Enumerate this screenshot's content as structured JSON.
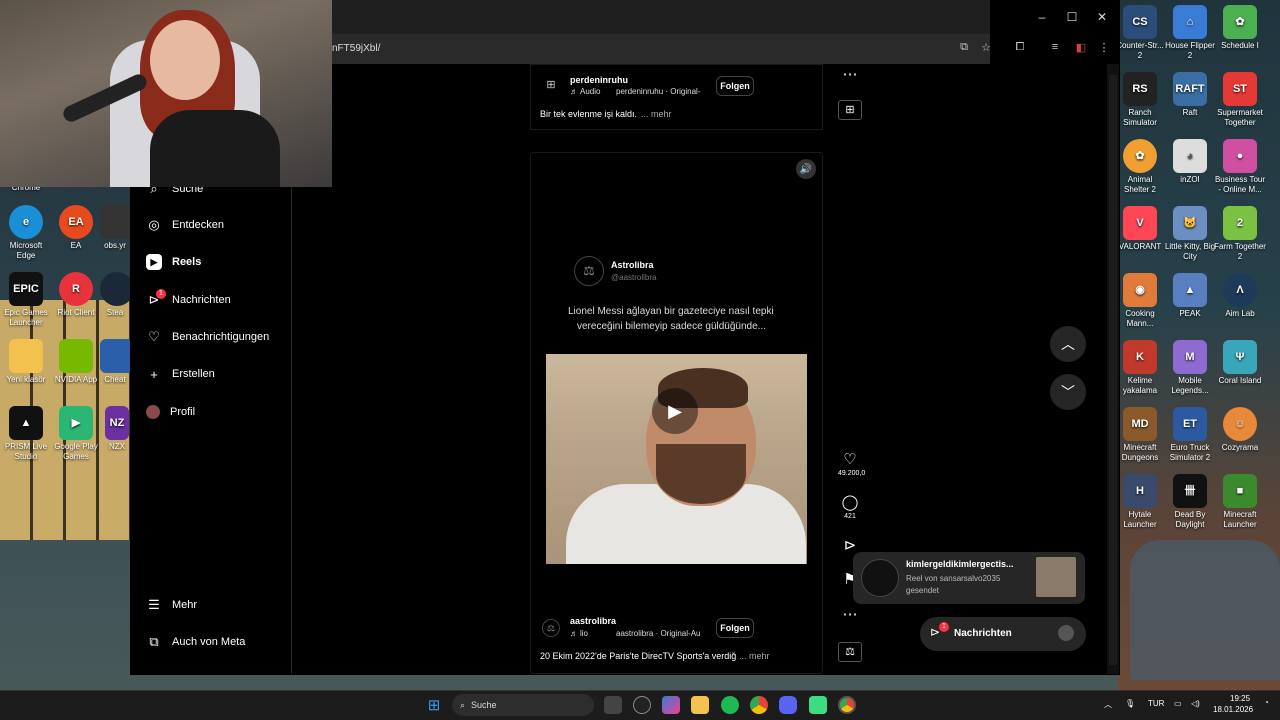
{
  "browser": {
    "url": "nFT59jXbl/",
    "window_controls": {
      "minimize": "–",
      "maximize": "☐",
      "close": "✕"
    }
  },
  "instagram": {
    "nav": [
      {
        "label": "Suche",
        "icon": "search-icon"
      },
      {
        "label": "Entdecken",
        "icon": "compass-icon"
      },
      {
        "label": "Reels",
        "icon": "reels-icon"
      },
      {
        "label": "Nachrichten",
        "icon": "messages-icon",
        "badge": "1"
      },
      {
        "label": "Benachrichtigungen",
        "icon": "heart-icon"
      },
      {
        "label": "Erstellen",
        "icon": "plus-icon"
      },
      {
        "label": "Profil",
        "icon": "avatar"
      }
    ],
    "more": "Mehr",
    "meta": "Auch von Meta"
  },
  "post1": {
    "username": "perdeninruhu",
    "audio": "Audio",
    "audio_source": "perdeninruhu · Original-",
    "follow": "Folgen",
    "caption": "Bir tek evlenme işi kaldı.",
    "more": "... mehr"
  },
  "reel": {
    "quote_name": "Astrolibra",
    "quote_handle": "@aastrolibra",
    "quote_text_1": "Lionel Messi ağlayan bir gazeteciye nasıl tepki",
    "quote_text_2": "vereceğini bilemeyip sadece güldüğünde...",
    "username": "aastrolibra",
    "audio": "lio",
    "audio_source": "aastrolibra · Original-Au",
    "follow": "Folgen",
    "caption": "20 Ekim 2022'de Paris'te DirecTV Sports'a verdiğ",
    "more": "... mehr"
  },
  "actions": {
    "likes": "49.200,0",
    "comments": "421"
  },
  "toast": {
    "title": "kimlergeldikimlergectis...",
    "line1": "Reel von sansarsalvo2035",
    "line2": "gesendet"
  },
  "messages_bar": {
    "label": "Nachrichten",
    "badge": "1"
  },
  "desktop_left": [
    {
      "label": "Chrome"
    },
    {
      "label": "Microsoft Edge"
    },
    {
      "label": "EA"
    },
    {
      "label": "obs.yr"
    },
    {
      "label": "Epic Games Launcher"
    },
    {
      "label": "Riot Client"
    },
    {
      "label": "Stea"
    },
    {
      "label": "Yeni klasör"
    },
    {
      "label": "NVIDIA App"
    },
    {
      "label": "Cheat"
    },
    {
      "label": "PRISM Live Studio"
    },
    {
      "label": "Google Play Games"
    },
    {
      "label": "NZX"
    }
  ],
  "desktop_right": [
    {
      "label": "Counter-Str... 2"
    },
    {
      "label": "House Flipper 2"
    },
    {
      "label": "Schedule I"
    },
    {
      "label": "Ranch Simulator"
    },
    {
      "label": "Raft"
    },
    {
      "label": "Supermarket Together"
    },
    {
      "label": "Animal Shelter 2"
    },
    {
      "label": "inZOI"
    },
    {
      "label": "Business Tour - Online M..."
    },
    {
      "label": "VALORANT"
    },
    {
      "label": "Little Kitty, Big City"
    },
    {
      "label": "Farm Together 2"
    },
    {
      "label": "Cooking Mann..."
    },
    {
      "label": "PEAK"
    },
    {
      "label": "Aim Lab"
    },
    {
      "label": "Kelime yakalama"
    },
    {
      "label": "Mobile Legends..."
    },
    {
      "label": "Coral Island"
    },
    {
      "label": "Minecraft Dungeons"
    },
    {
      "label": "Euro Truck Simulator 2"
    },
    {
      "label": "Cozyrama"
    },
    {
      "label": "Hytale Launcher"
    },
    {
      "label": "Dead By Daylight"
    },
    {
      "label": "Minecraft Launcher"
    }
  ],
  "taskbar": {
    "search": "Suche",
    "lang": "TUR",
    "time": "19:25",
    "date": "18.01.2026"
  }
}
